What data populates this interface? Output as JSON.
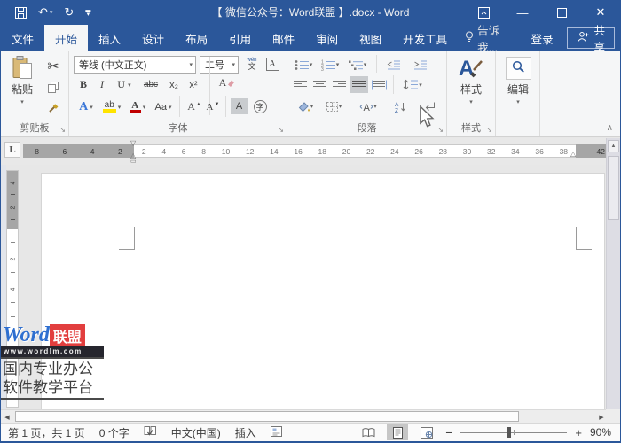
{
  "titlebar": {
    "title": "【 微信公众号：Word联盟 】.docx - Word"
  },
  "tabs": {
    "file": "文件",
    "home": "开始",
    "insert": "插入",
    "design": "设计",
    "layout": "布局",
    "references": "引用",
    "mailings": "邮件",
    "review": "审阅",
    "view": "视图",
    "developer": "开发工具",
    "tell_me": "告诉我...",
    "sign_in": "登录",
    "share": "共享"
  },
  "ribbon": {
    "clipboard": {
      "paste": "粘贴",
      "label": "剪贴板"
    },
    "font": {
      "name": "等线 (中文正文)",
      "size": "二号",
      "bold": "B",
      "italic": "I",
      "underline": "U",
      "strikethrough": "abc",
      "subscript": "x₂",
      "superscript": "x²",
      "phonetic_top": "wén",
      "phonetic_bottom": "文",
      "char_border": "A",
      "clear_formatting": "A",
      "text_effects": "A",
      "highlight": "ab",
      "font_color": "A",
      "change_case": "Aa",
      "grow_font": "A",
      "shrink_font": "A",
      "char_shading": "A",
      "enclose": "字",
      "label": "字体"
    },
    "paragraph": {
      "label": "段落"
    },
    "styles": {
      "button": "样式",
      "label": "样式"
    },
    "editing": {
      "button": "编辑"
    }
  },
  "ruler": {
    "tab_selector": "L",
    "left_numbers": [
      "8",
      "6",
      "4",
      "2"
    ],
    "numbers": [
      "2",
      "4",
      "6",
      "8",
      "10",
      "12",
      "14",
      "16",
      "18",
      "20",
      "22",
      "24",
      "26",
      "28",
      "30",
      "32",
      "34",
      "36",
      "38"
    ],
    "right_number": "42"
  },
  "vruler": {
    "margin_numbers": [
      "4",
      "2"
    ],
    "body_numbers": [
      "2",
      "4"
    ]
  },
  "watermark": {
    "brand": "Word",
    "brand_suffix": "联盟",
    "url": "www.wordlm.com",
    "tagline1": "国内专业办公",
    "tagline2": "软件教学平台"
  },
  "statusbar": {
    "page_info": "第 1 页，共 1 页",
    "word_count": "0 个字",
    "language": "中文(中国)",
    "insert_mode": "插入",
    "zoom_out": "−",
    "zoom_in": "+",
    "zoom_level": "90%"
  },
  "colors": {
    "accent": "#2B579A",
    "highlight_yellow": "#FFE400",
    "font_color_red": "#C00000",
    "logo_red": "#E23E3E",
    "logo_blue": "#2E6FD0"
  }
}
